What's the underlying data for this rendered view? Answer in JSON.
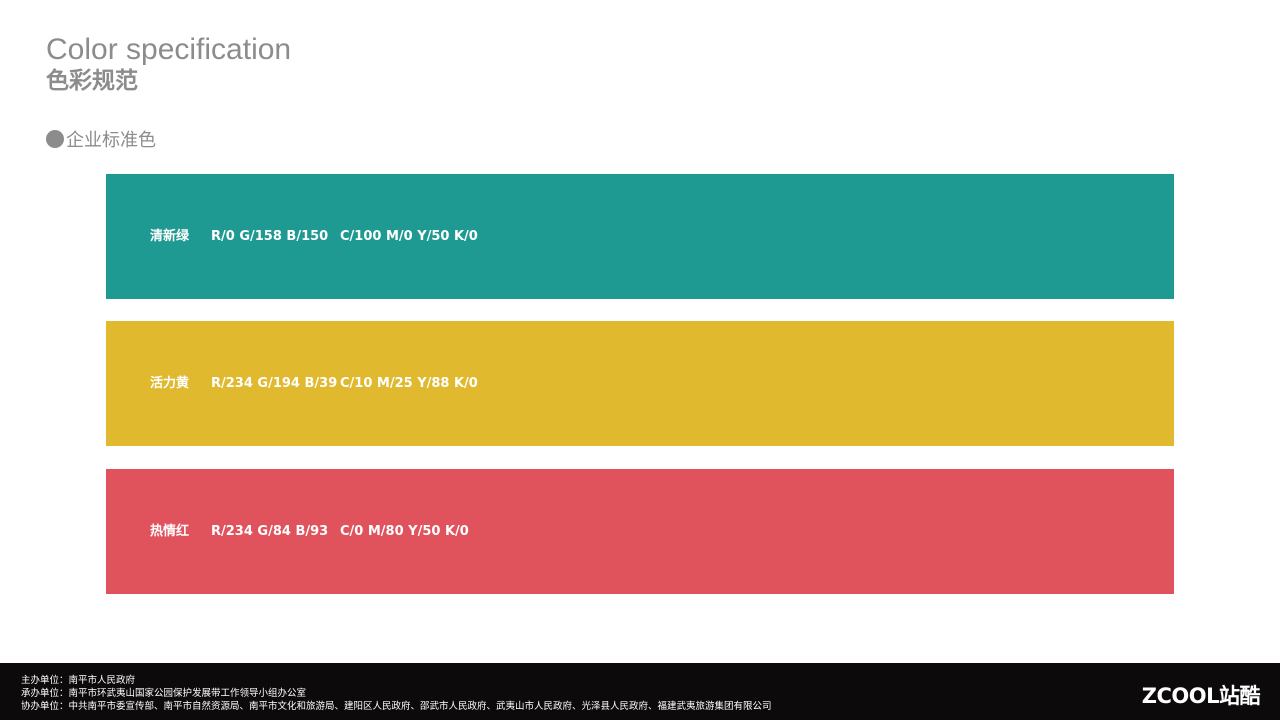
{
  "header": {
    "title_en": "Color specification",
    "title_cn": "色彩规范"
  },
  "section": {
    "label": "企业标准色"
  },
  "swatches": [
    {
      "name": "清新绿",
      "rgb": "R/0 G/158 B/150",
      "cmyk": "C/100 M/0 Y/50 K/0",
      "color": "#1f9a92"
    },
    {
      "name": "活力黄",
      "rgb": "R/234 G/194 B/39",
      "cmyk": "C/10 M/25 Y/88 K/0",
      "color": "#e0b92e"
    },
    {
      "name": "热情红",
      "rgb": "R/234 G/84 B/93",
      "cmyk": "C/0 M/80 Y/50 K/0",
      "color": "#e0535d"
    }
  ],
  "footer": {
    "line1": "主办单位：南平市人民政府",
    "line2": "承办单位：南平市环武夷山国家公园保护发展带工作领导小组办公室",
    "line3": "协办单位：中共南平市委宣传部、南平市自然资源局、南平市文化和旅游局、建阳区人民政府、邵武市人民政府、武夷山市人民政府、光泽县人民政府、福建武夷旅游集团有限公司",
    "logo": "ZCOOL站酷"
  }
}
